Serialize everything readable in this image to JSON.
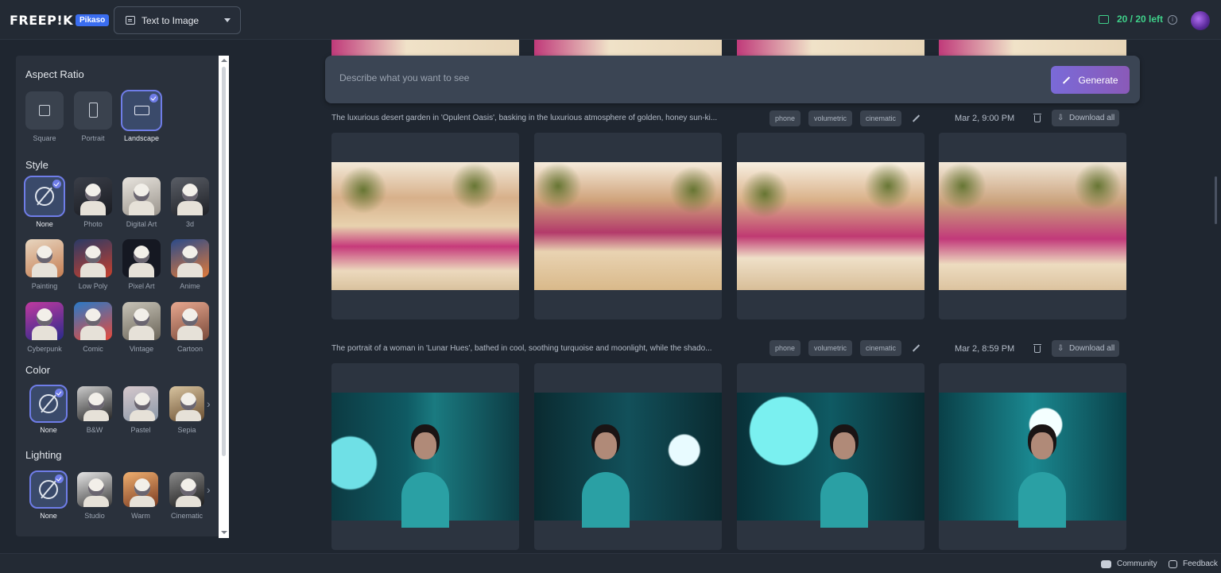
{
  "header": {
    "logo": "FREEP!K",
    "badge": "Pikaso",
    "mode": "Text to Image",
    "credits": "20 / 20 left"
  },
  "sidebar": {
    "aspect_title": "Aspect Ratio",
    "aspect": [
      "Square",
      "Portrait",
      "Landscape"
    ],
    "style_title": "Style",
    "styles": [
      "None",
      "Photo",
      "Digital Art",
      "3d",
      "Painting",
      "Low Poly",
      "Pixel Art",
      "Anime",
      "Cyberpunk",
      "Comic",
      "Vintage",
      "Cartoon"
    ],
    "color_title": "Color",
    "colors": [
      "None",
      "B&W",
      "Pastel",
      "Sepia"
    ],
    "lighting_title": "Lighting",
    "lighting": [
      "None",
      "Studio",
      "Warm",
      "Cinematic"
    ]
  },
  "prompt": {
    "placeholder": "Describe what you want to see",
    "generate_label": "Generate"
  },
  "groups": [
    {
      "description": "The luxurious desert garden in 'Opulent Oasis', basking in the luxurious atmosphere of golden, honey sun-ki...",
      "tags": [
        "phone",
        "volumetric",
        "cinematic"
      ],
      "time": "Mar 2, 9:00 PM",
      "download_label": "Download all"
    },
    {
      "description": "The portrait of a woman in 'Lunar Hues', bathed in cool, soothing turquoise and moonlight, while the shado...",
      "tags": [
        "phone",
        "volumetric",
        "cinematic"
      ],
      "time": "Mar 2, 8:59 PM",
      "download_label": "Download all"
    }
  ],
  "footer": {
    "community": "Community",
    "feedback": "Feedback"
  },
  "colors": {
    "accent": "#6f7de8",
    "credits": "#3fd18a",
    "generate": "#7a6ad8"
  }
}
